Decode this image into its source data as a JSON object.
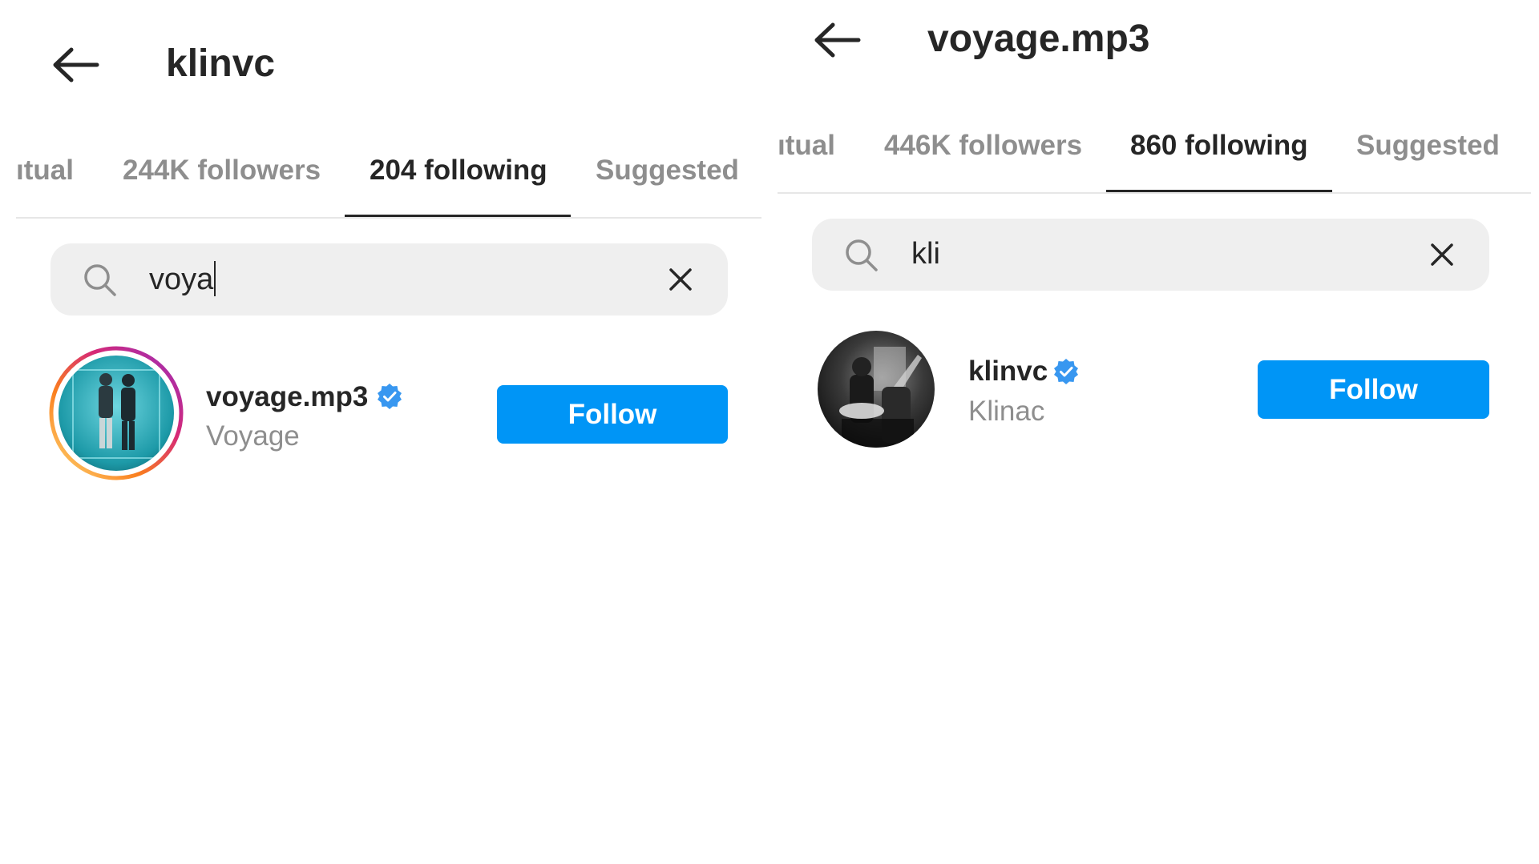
{
  "panels": {
    "left": {
      "title": "klinvc",
      "tabs": {
        "mutual_partial": "ıtual",
        "followers": "244K followers",
        "following": "204 following",
        "suggested": "Suggested"
      },
      "search": {
        "value": "voya"
      },
      "result": {
        "username": "voyage.mp3",
        "full_name": "Voyage",
        "verified": true,
        "button_label": "Follow"
      }
    },
    "right": {
      "title": "voyage.mp3",
      "tabs": {
        "mutual_partial": "ıtual",
        "followers": "446K followers",
        "following": "860 following",
        "suggested": "Suggested"
      },
      "search": {
        "value": "kli"
      },
      "result": {
        "username": "klinvc",
        "full_name": "Klinac",
        "verified": true,
        "button_label": "Follow"
      }
    }
  },
  "colors": {
    "follow_button": "#0095f6",
    "verified_badge": "#3897f0",
    "text_primary": "#262626",
    "text_secondary": "#8e8e8e",
    "search_background": "#efefef"
  },
  "icons": {
    "back": "back-arrow-icon",
    "search": "search-icon",
    "clear": "close-icon",
    "verified": "verified-badge-icon"
  }
}
